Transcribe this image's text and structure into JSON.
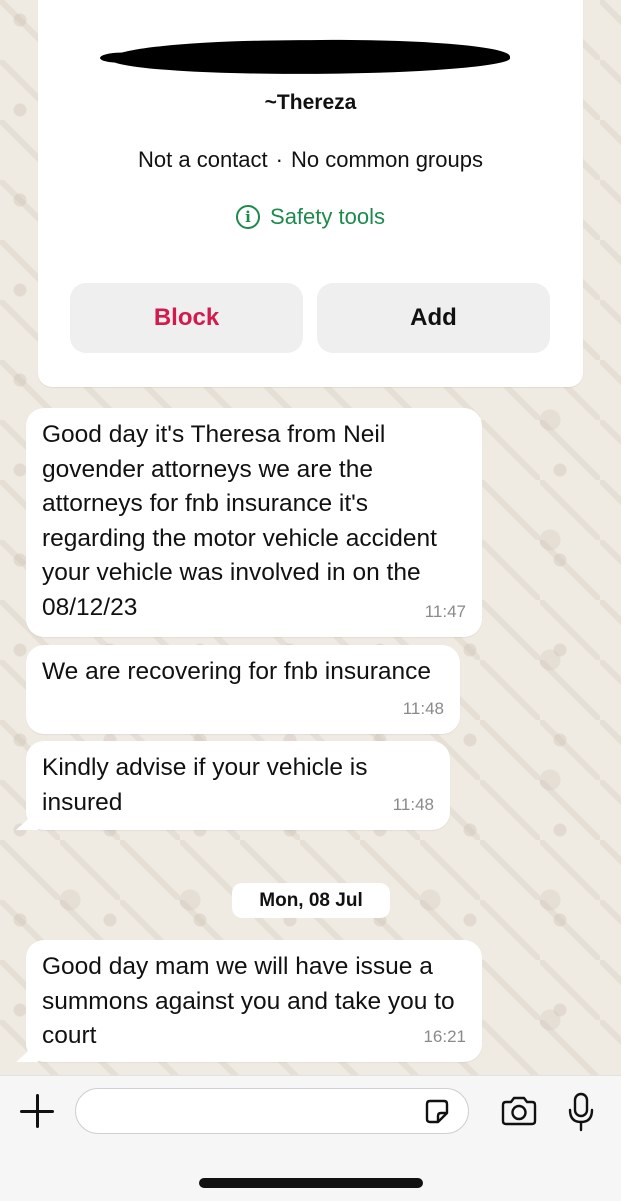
{
  "contact": {
    "name": "~Thereza",
    "meta_status": "Not a contact",
    "meta_separator": "·",
    "meta_groups": "No common groups",
    "safety_tools_label": "Safety tools",
    "block_label": "Block",
    "add_label": "Add"
  },
  "messages": [
    {
      "text": "Good day it's Theresa from Neil govender attorneys we are the attorneys for fnb insurance it's regarding the motor vehicle accident your vehicle was involved in on the 08/12/23",
      "time": "11:47"
    },
    {
      "text": "We are recovering for fnb insurance",
      "time": "11:48"
    },
    {
      "text": "Kindly advise if your vehicle is insured",
      "time": "11:48"
    },
    {
      "text": "Good day mam we will have issue a summons against you and take you to court",
      "time": "16:21"
    }
  ],
  "date_divider": "Mon, 08 Jul",
  "composer": {
    "input_value": "",
    "icons": [
      "plus-icon",
      "sticker-icon",
      "camera-icon",
      "microphone-icon"
    ]
  },
  "colors": {
    "block_red": "#d31a4d",
    "safety_green": "#1d8a4d",
    "wallpaper": "#efeae2"
  }
}
